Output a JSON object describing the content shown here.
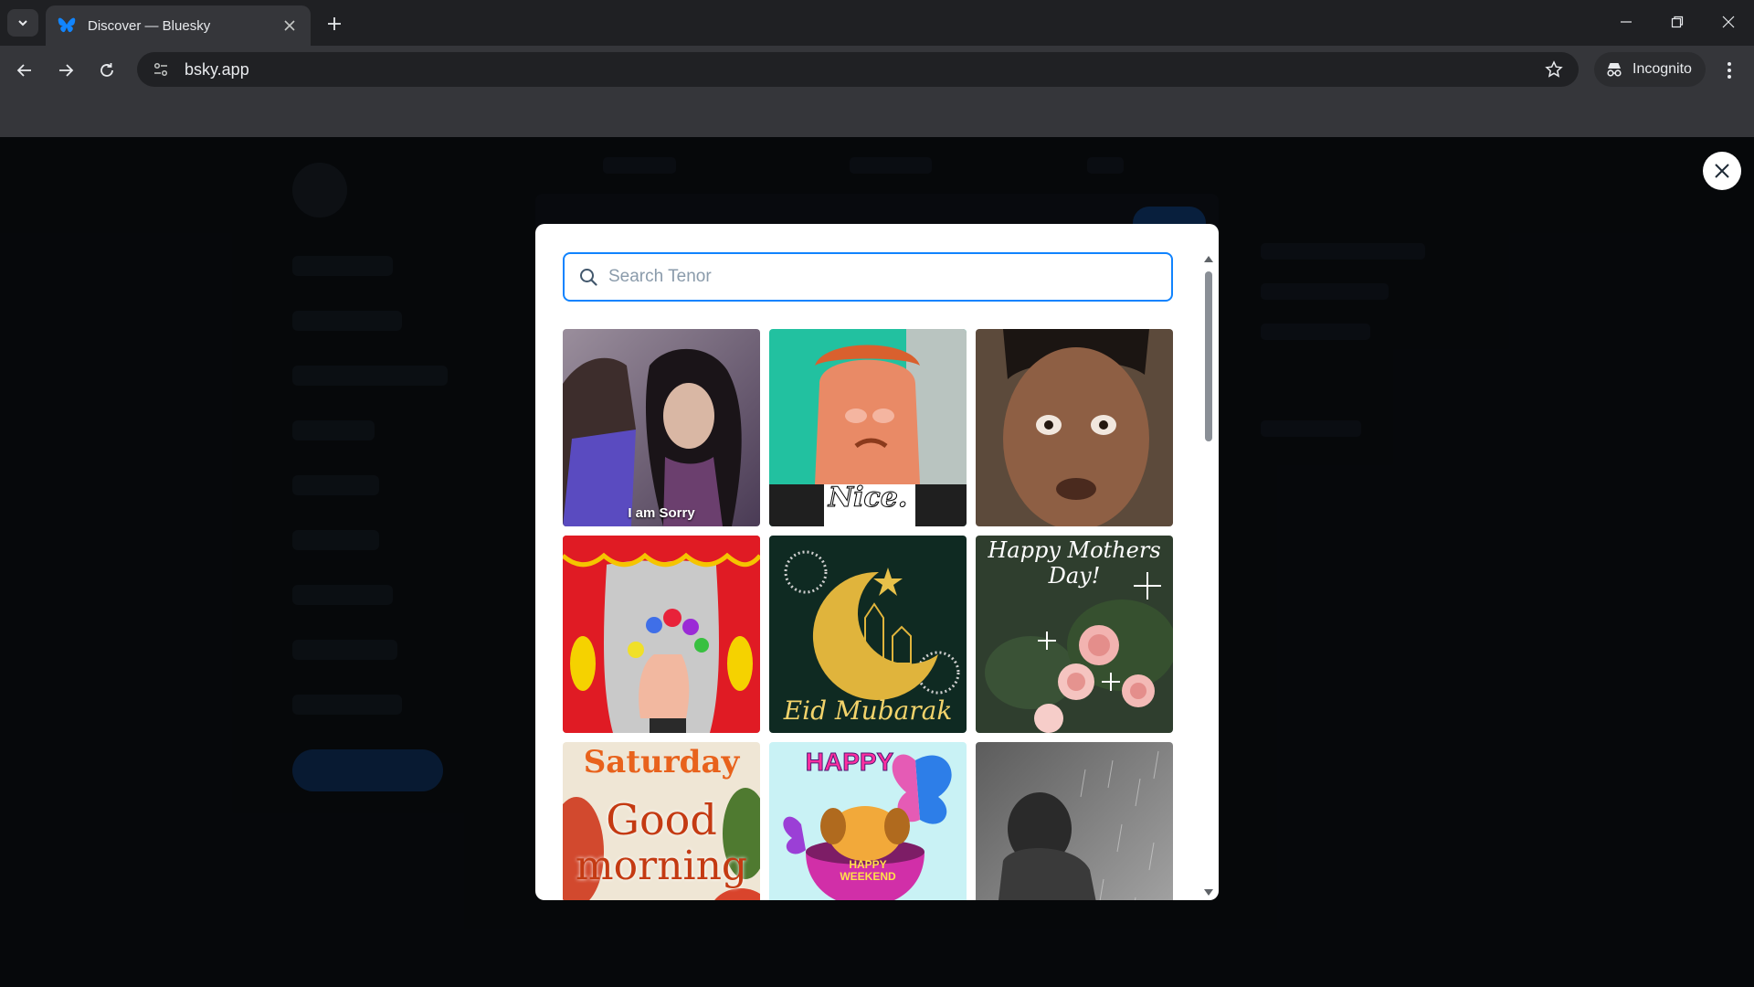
{
  "browser": {
    "tab_title": "Discover — Bluesky",
    "url": "bsky.app",
    "incognito_label": "Incognito"
  },
  "modal": {
    "search_placeholder": "Search Tenor",
    "search_value": "",
    "gifs": [
      {
        "name": "gif-i-am-sorry",
        "caption": "I am Sorry"
      },
      {
        "name": "gif-nice",
        "caption": "Nice."
      },
      {
        "name": "gif-shocked-man",
        "caption": ""
      },
      {
        "name": "gif-finger-puppets",
        "caption": ""
      },
      {
        "name": "gif-eid-mubarak",
        "caption": "Eid Mubarak"
      },
      {
        "name": "gif-happy-mothers-day",
        "caption": "Happy Mothers Day!"
      },
      {
        "name": "gif-saturday-good-morning",
        "caption_top": "Saturday",
        "caption_mid": "Good",
        "caption_bottom": "morning"
      },
      {
        "name": "gif-happy-weekend",
        "caption_top": "HAPPY",
        "caption_bottom": "HAPPY WEEKEND"
      },
      {
        "name": "gif-sad-rain",
        "caption": ""
      }
    ]
  },
  "colors": {
    "accent": "#1083fe",
    "modal_bg": "#ffffff"
  },
  "icons": {
    "tab_favicon": "bluesky-butterfly-icon",
    "search": "search-icon",
    "overlay_close": "close-icon"
  }
}
